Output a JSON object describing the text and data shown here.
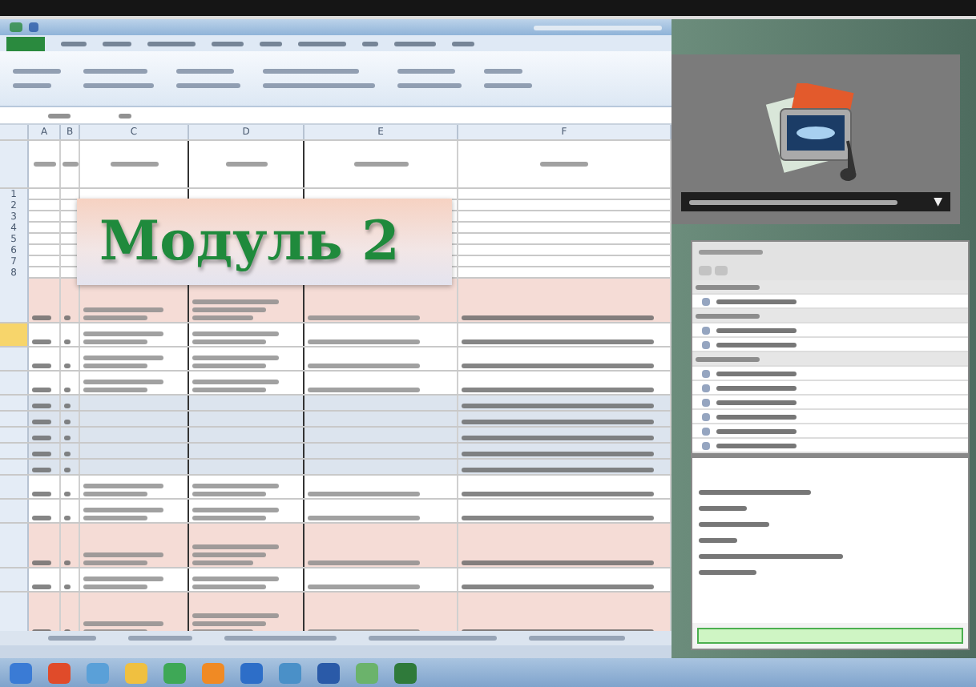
{
  "banner": {
    "title": "Модуль 2"
  },
  "columns": [
    "A",
    "B",
    "C",
    "D",
    "E",
    "F"
  ],
  "empty_rows": [
    "1",
    "2",
    "3",
    "4",
    "5",
    "6",
    "7",
    "8"
  ],
  "rows": [
    {
      "kind": "highlighted",
      "selected": false
    },
    {
      "kind": "entry",
      "selected": true
    },
    {
      "kind": "entry",
      "selected": false
    },
    {
      "kind": "entry",
      "selected": false
    },
    {
      "kind": "empty",
      "selected": false
    },
    {
      "kind": "empty",
      "selected": false
    },
    {
      "kind": "empty",
      "selected": false
    },
    {
      "kind": "empty",
      "selected": false
    },
    {
      "kind": "empty",
      "selected": false
    },
    {
      "kind": "entry",
      "selected": false
    },
    {
      "kind": "entry",
      "selected": false
    },
    {
      "kind": "highlighted",
      "selected": false
    },
    {
      "kind": "entry",
      "selected": false
    },
    {
      "kind": "highlighted",
      "selected": false
    }
  ],
  "media_player": {
    "menu_glyph": "▼"
  },
  "chat": {
    "list_items": [
      {
        "kind": "section"
      },
      {
        "kind": "item"
      },
      {
        "kind": "section"
      },
      {
        "kind": "item"
      },
      {
        "kind": "item"
      },
      {
        "kind": "section"
      },
      {
        "kind": "item"
      },
      {
        "kind": "item"
      },
      {
        "kind": "item"
      },
      {
        "kind": "item"
      },
      {
        "kind": "item"
      },
      {
        "kind": "item"
      }
    ]
  }
}
